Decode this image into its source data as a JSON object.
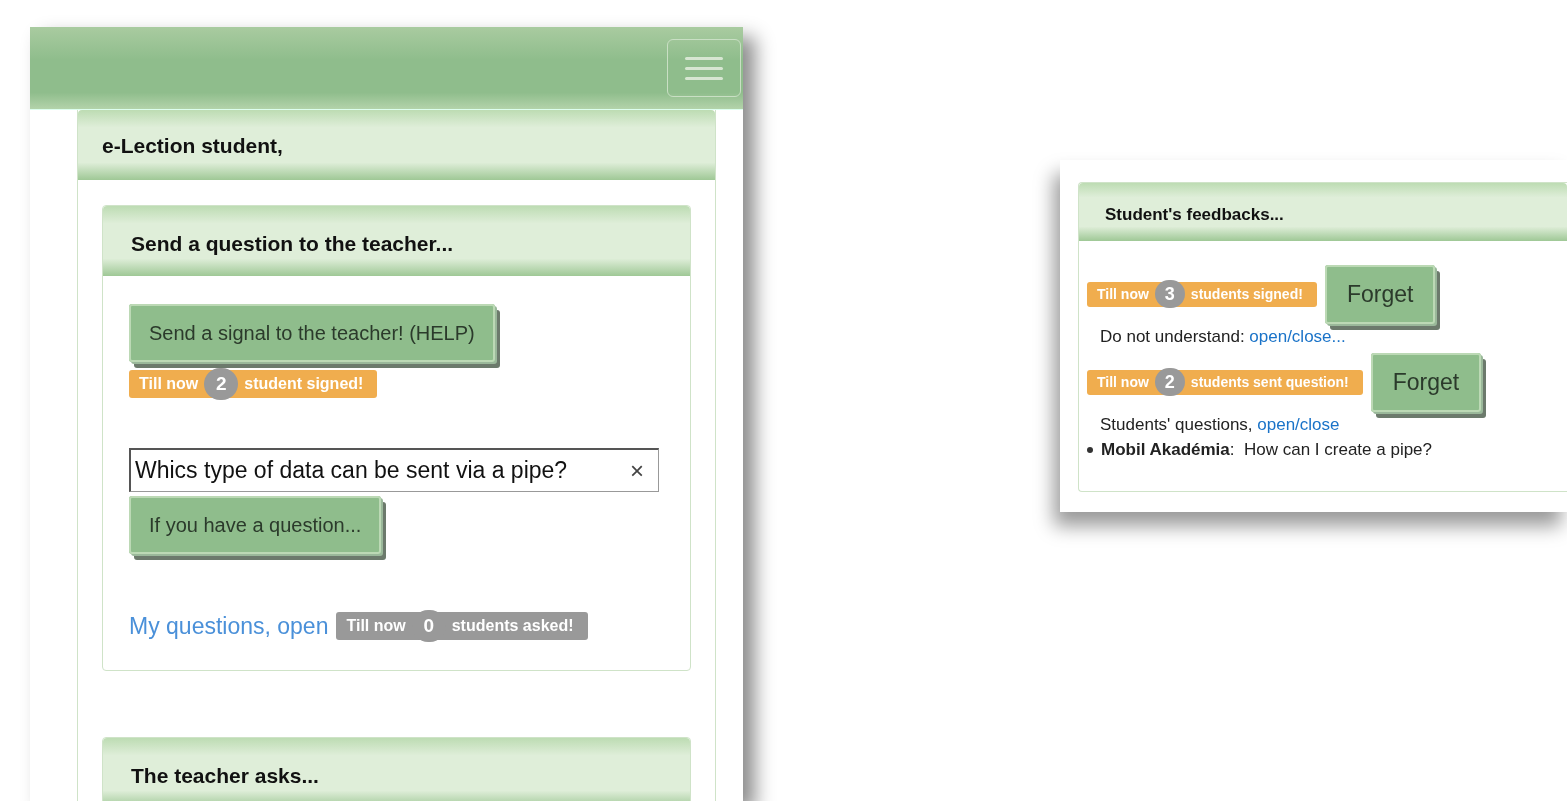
{
  "app": {
    "title": "e-Lection student,",
    "sections": [
      {
        "title": "Send a question to the teacher...",
        "signal_button": "Send a signal to the teacher! (HELP)",
        "signal_badge": {
          "kind": "warning",
          "prefix": "Till now",
          "count": "2",
          "suffix": "student signed!"
        },
        "question_field": {
          "value": "Whics type of data can be sent via a pipe?",
          "clear": "×"
        },
        "question_button": "If you have a question...",
        "my_questions_link": "My questions, open",
        "asked_badge": {
          "kind": "secondary",
          "prefix": "Till now",
          "count": "0",
          "suffix": "students asked!"
        }
      },
      {
        "title": "The teacher asks..."
      }
    ]
  },
  "feedback_panel": {
    "title": "Student's feedbacks...",
    "groups": [
      {
        "badge": {
          "kind": "warning",
          "prefix": "Till now",
          "count": "3",
          "suffix": "students signed!"
        },
        "button": "Forget",
        "text": "Do not understand: ",
        "link": "open/close..."
      },
      {
        "badge": {
          "kind": "warning",
          "prefix": "Till now",
          "count": "2",
          "suffix": "students sent question!"
        },
        "button": "Forget",
        "text": "Students' questions, ",
        "link": "open/close",
        "items": [
          "**Mobil Akadémia**:  How can I create a pipe?"
        ]
      }
    ]
  }
}
